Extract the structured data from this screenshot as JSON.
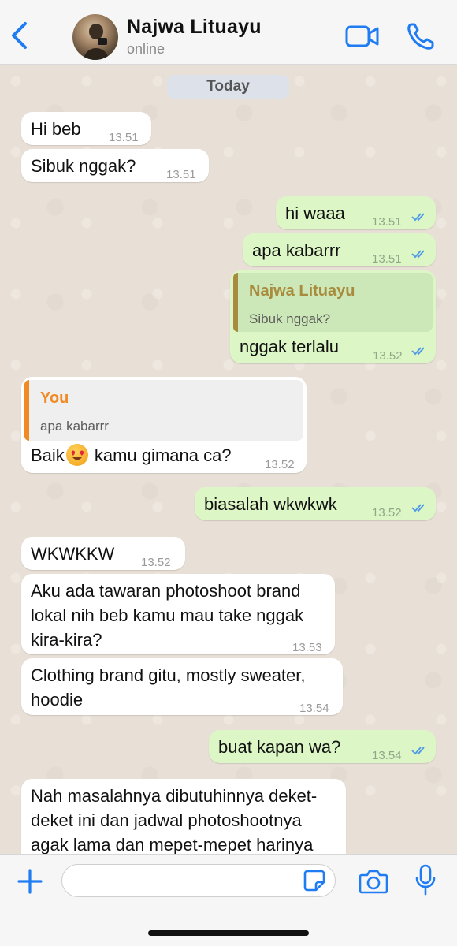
{
  "header": {
    "contact_name": "Najwa Lituayu",
    "status": "online",
    "accent_color": "#1f7cf2"
  },
  "chat": {
    "date_label": "Today",
    "messages": [
      {
        "direction": "in",
        "text": "Hi beb",
        "time": "13.51"
      },
      {
        "direction": "in",
        "text": "Sibuk nggak?",
        "time": "13.51"
      },
      {
        "direction": "out",
        "text": "hi waaa",
        "time": "13.51",
        "read": true
      },
      {
        "direction": "out",
        "text": "apa kabarrr",
        "time": "13.51",
        "read": true
      },
      {
        "direction": "out",
        "text": "nggak terlalu",
        "time": "13.52",
        "read": true,
        "quote": {
          "name": "Najwa Lituayu",
          "text": "Sibuk nggak?",
          "name_color": "#a88b3d"
        }
      },
      {
        "direction": "in",
        "text_before": "Baik",
        "emoji": "heart-eyes-emoji",
        "text_after": " kamu gimana ca?",
        "time": "13.52",
        "quote": {
          "name": "You",
          "text": "apa kabarrr",
          "name_color": "#f08a24"
        }
      },
      {
        "direction": "out",
        "text": "biasalah wkwkwk",
        "time": "13.52",
        "read": true
      },
      {
        "direction": "in",
        "text": "WKWKKW",
        "time": "13.52"
      },
      {
        "direction": "in",
        "lines": [
          "Aku ada tawaran photoshoot brand",
          "lokal nih beb kamu mau take nggak",
          "kira-kira?"
        ],
        "time": "13.53"
      },
      {
        "direction": "in",
        "lines": [
          "Clothing brand gitu, mostly sweater,",
          "hoodie"
        ],
        "time": "13.54"
      },
      {
        "direction": "out",
        "text": "buat kapan wa?",
        "time": "13.54",
        "read": true
      },
      {
        "direction": "in",
        "lines": [
          "Nah masalahnya dibutuhinnya deket-",
          "deket ini dan jadwal photoshootnya",
          "agak lama dan mepet-mepet harinya"
        ]
      }
    ]
  },
  "composer": {
    "value": "",
    "icons": [
      "plus-icon",
      "sticker-icon",
      "camera-icon",
      "mic-icon"
    ]
  }
}
